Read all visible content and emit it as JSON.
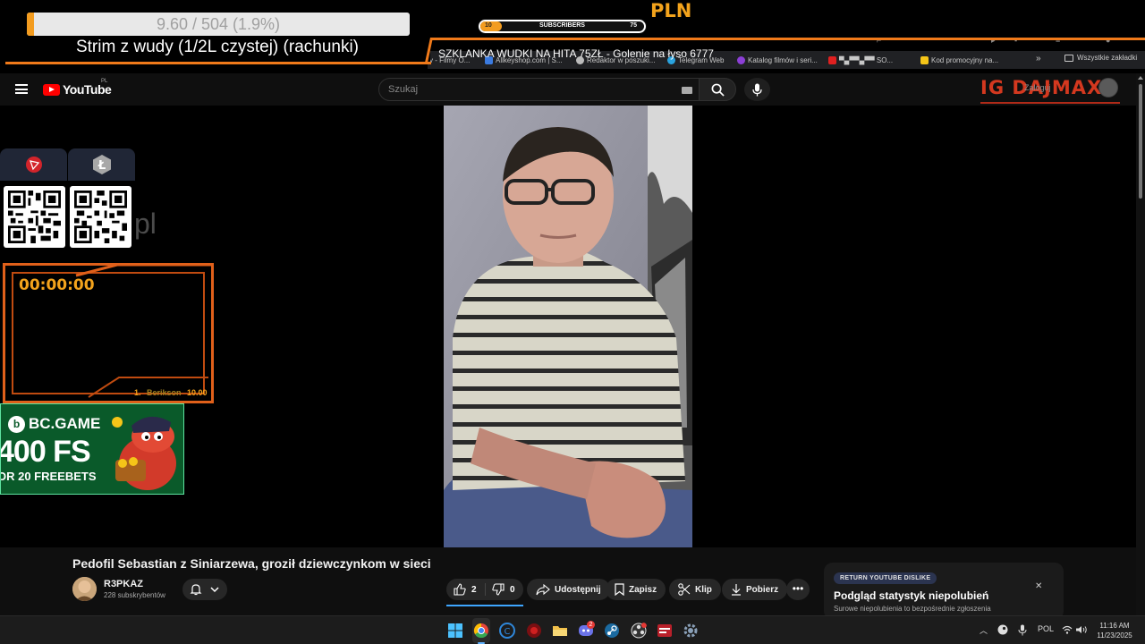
{
  "overlay": {
    "goal_text": "9.60 / 504 (1.9%)",
    "goal_percent": 1.9,
    "stream_title": "Strim z wudy (1/2L czystej) (rachunki)",
    "subs_current": "10",
    "subs_label": "SUBSCRIBERS",
    "subs_goal": "75",
    "subs_fraction": 0.13,
    "currency": "PLN",
    "ticker": "SZKLANKA WUDKI NA HITA 75ZŁ - Golenie na łyso 6777",
    "pl_text": "pl",
    "timer": "00:00:00",
    "leader_rank": "1.",
    "leader_name": "Berikson",
    "leader_amount": "10.00",
    "ig_badge": "IG DAJMAX",
    "ig_sign": "Zaloguj"
  },
  "bookmarks": {
    "items": [
      {
        "label": "v - Filmy O...",
        "color": "#888888"
      },
      {
        "label": "Allkeyshop.com | S...",
        "color": "#3b7be0"
      },
      {
        "label": "Redaktor w poszuki...",
        "color": "#bbbbbb"
      },
      {
        "label": "Telegram Web",
        "color": "#2aa3de"
      },
      {
        "label": "Katalog filmów i seri...",
        "color": "#8c3fd6"
      },
      {
        "label": "▀▄▀▀▄▀▀ SO...",
        "color": "#e02020"
      },
      {
        "label": "Kod promocyjny na...",
        "color": "#f5c518"
      }
    ],
    "all_label": "Wszystkie zakładki"
  },
  "youtube": {
    "logo_text": "YouTube",
    "region": "PL",
    "search_placeholder": "Szukaj"
  },
  "video": {
    "title": "Pedofil Sebastian z Siniarzewa, groził dziewczynkom w sieci",
    "channel": "R3PKAZ",
    "subscribers": "228 subskrybentów",
    "likes": "2",
    "dislikes": "0",
    "share": "Udostępnij",
    "save": "Zapisz",
    "clip": "Klip",
    "download": "Pobierz"
  },
  "dislike_card": {
    "tag": "RETURN YOUTUBE DISLIKE",
    "title": "Podgląd statystyk niepolubień",
    "subtitle": "Surowe niepolubienia to bezpośrednie zgłoszenia"
  },
  "ads": {
    "bc_logo": "BC.GAME",
    "bc_fs": "400 FS",
    "bc_freebets": "OR 20 FREEBETS"
  },
  "taskbar": {
    "apps": [
      {
        "name": "windows-start-icon",
        "color": "#4cc2ff"
      },
      {
        "name": "chrome-icon",
        "color": "#e8453c"
      },
      {
        "name": "c-app-icon",
        "color": "#2f86d8"
      },
      {
        "name": "red-app-icon",
        "color": "#d02020"
      },
      {
        "name": "file-explorer-icon",
        "color": "#f2c04a"
      },
      {
        "name": "discord-icon",
        "color": "#6a72e8"
      },
      {
        "name": "steam-icon",
        "color": "#1b6aa0"
      },
      {
        "name": "obs-icon",
        "color": "#555555"
      },
      {
        "name": "media-icon",
        "color": "#b8202a"
      },
      {
        "name": "settings-icon",
        "color": "#8aa0b8"
      }
    ],
    "discord_badge": "2",
    "language": "POL",
    "time": "11:16 AM",
    "date": "11/23/2025"
  },
  "colors": {
    "accent_orange": "#f39c1f",
    "frame_orange": "#e0601a",
    "yt_red": "#ff0000",
    "like_blue": "#3ea6ff"
  }
}
